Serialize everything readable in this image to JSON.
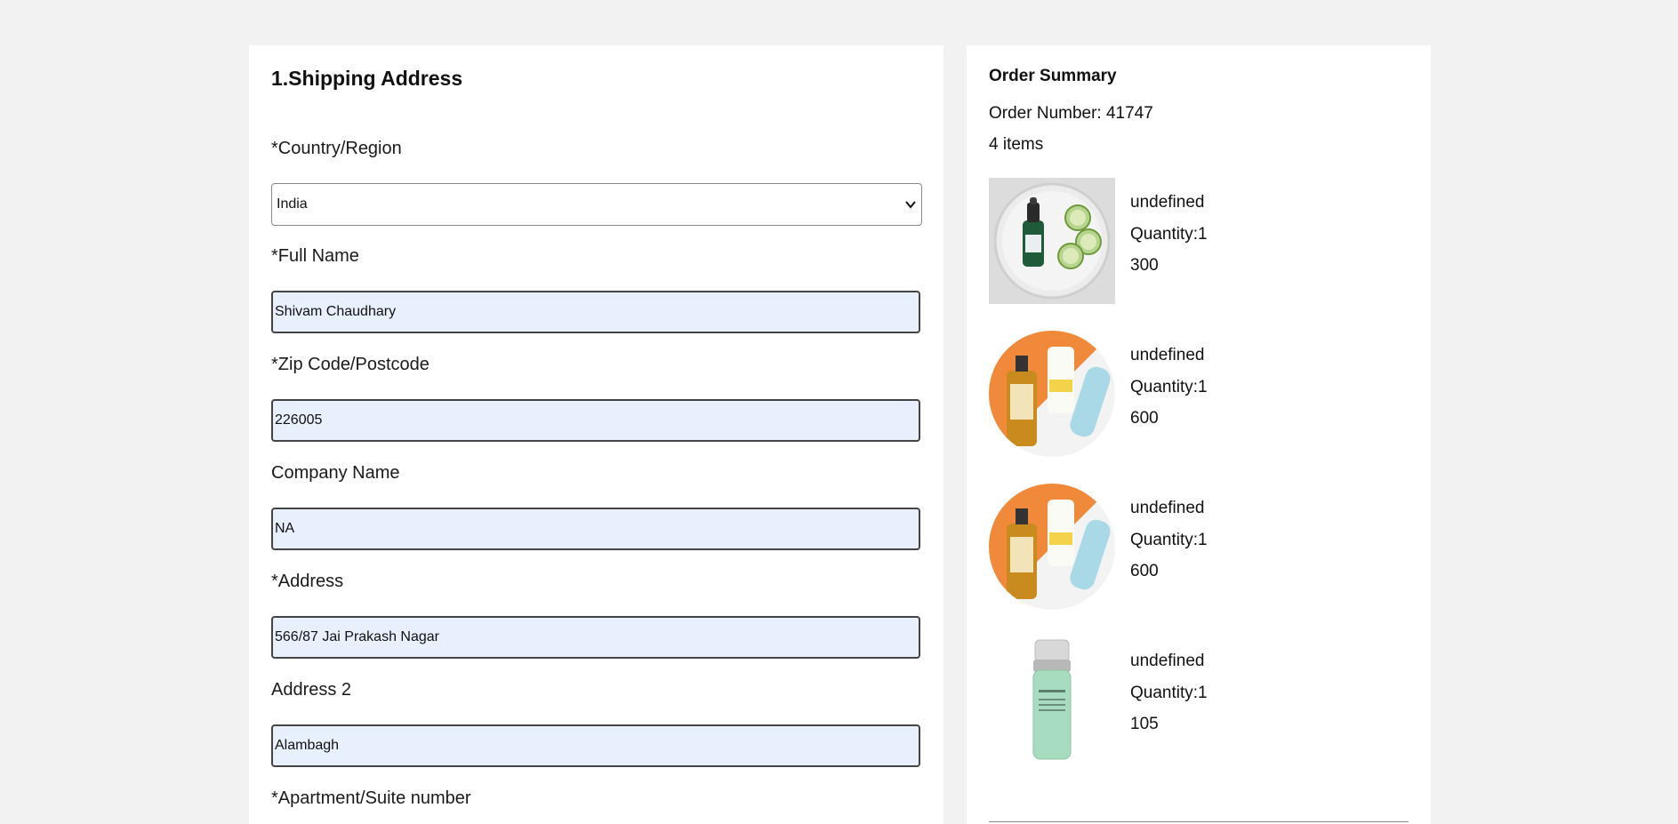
{
  "shipping": {
    "title": "1.Shipping Address",
    "country_label": "*Country/Region",
    "country_value": "India",
    "full_name_label": "*Full Name",
    "full_name_value": "Shivam Chaudhary",
    "zip_label": "*Zip Code/Postcode",
    "zip_value": "226005",
    "company_label": "Company Name",
    "company_value": "NA",
    "address_label": "*Address",
    "address_value": "566/87 Jai Prakash Nagar",
    "address2_label": "Address 2",
    "address2_value": "Alambagh",
    "apartment_label": "*Apartment/Suite number"
  },
  "summary": {
    "title": "Order Summary",
    "order_number": "Order Number: 41747",
    "item_count": "4 items",
    "items": [
      {
        "name": "undefined",
        "quantity": "Quantity:1",
        "price": "300",
        "image": "serum-dropper-bottle-with-cucumbers"
      },
      {
        "name": "undefined",
        "quantity": "Quantity:1",
        "price": "600",
        "image": "cleansing-oil-and-skincare-set"
      },
      {
        "name": "undefined",
        "quantity": "Quantity:1",
        "price": "600",
        "image": "cleansing-oil-and-skincare-set"
      },
      {
        "name": "undefined",
        "quantity": "Quantity:1",
        "price": "105",
        "image": "green-pump-serum-bottle"
      }
    ]
  }
}
